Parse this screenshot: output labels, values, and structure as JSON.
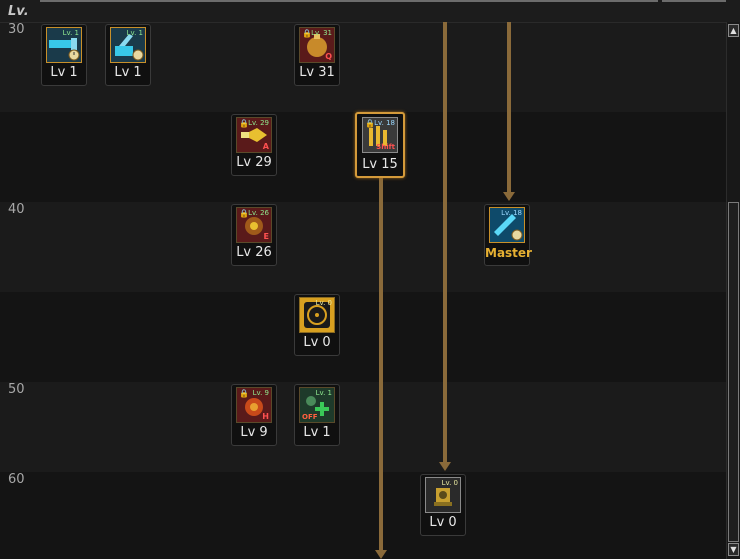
{
  "header": {
    "lv_label": "Lv."
  },
  "levels": [
    {
      "id": "30",
      "label": "30"
    },
    {
      "id": "40",
      "label": "40"
    },
    {
      "id": "50",
      "label": "50"
    },
    {
      "id": "60",
      "label": "60"
    }
  ],
  "skills": [
    {
      "id": "skill-1",
      "level_text": "Lv 1",
      "mini_level": "Lv. 1",
      "icon": "cannon-clock-icon",
      "key": "",
      "locked": false
    },
    {
      "id": "skill-2",
      "level_text": "Lv 1",
      "mini_level": "Lv. 1",
      "icon": "turret-clock-icon",
      "key": "",
      "locked": false
    },
    {
      "id": "skill-3",
      "level_text": "Lv 31",
      "mini_level": "Lv. 31",
      "icon": "grenade-icon",
      "key": "Q",
      "locked": true
    },
    {
      "id": "skill-4",
      "level_text": "Lv 29",
      "mini_level": "Lv. 29",
      "icon": "blast-icon",
      "key": "A",
      "locked": true
    },
    {
      "id": "skill-5",
      "level_text": "Lv 15",
      "mini_level": "Lv. 18",
      "icon": "barrage-icon",
      "key": "Shift",
      "locked": true,
      "selected": true
    },
    {
      "id": "skill-6",
      "level_text": "Master",
      "mini_level": "Lv. 18",
      "icon": "rail-clock-icon",
      "key": "",
      "locked": false
    },
    {
      "id": "skill-7",
      "level_text": "Lv 26",
      "mini_level": "Lv. 26",
      "icon": "mine-icon",
      "key": "E",
      "locked": true
    },
    {
      "id": "skill-8",
      "level_text": "Lv 0",
      "mini_level": "Lv. 0",
      "icon": "target-icon",
      "key": "",
      "locked": false
    },
    {
      "id": "skill-9",
      "level_text": "Lv 9",
      "mini_level": "Lv. 9",
      "icon": "bomb-icon",
      "key": "H",
      "locked": true
    },
    {
      "id": "skill-10",
      "level_text": "Lv 1",
      "mini_level": "Lv. 1",
      "icon": "heal-plus-icon",
      "key": "OFF",
      "locked": false
    },
    {
      "id": "skill-11",
      "level_text": "Lv 0",
      "mini_level": "Lv. 0",
      "icon": "mech-icon",
      "key": "",
      "locked": false
    }
  ],
  "colors": {
    "arrow": "#8a6a3a",
    "selected_border": "#d49a3a",
    "master_text": "#e6b032"
  }
}
